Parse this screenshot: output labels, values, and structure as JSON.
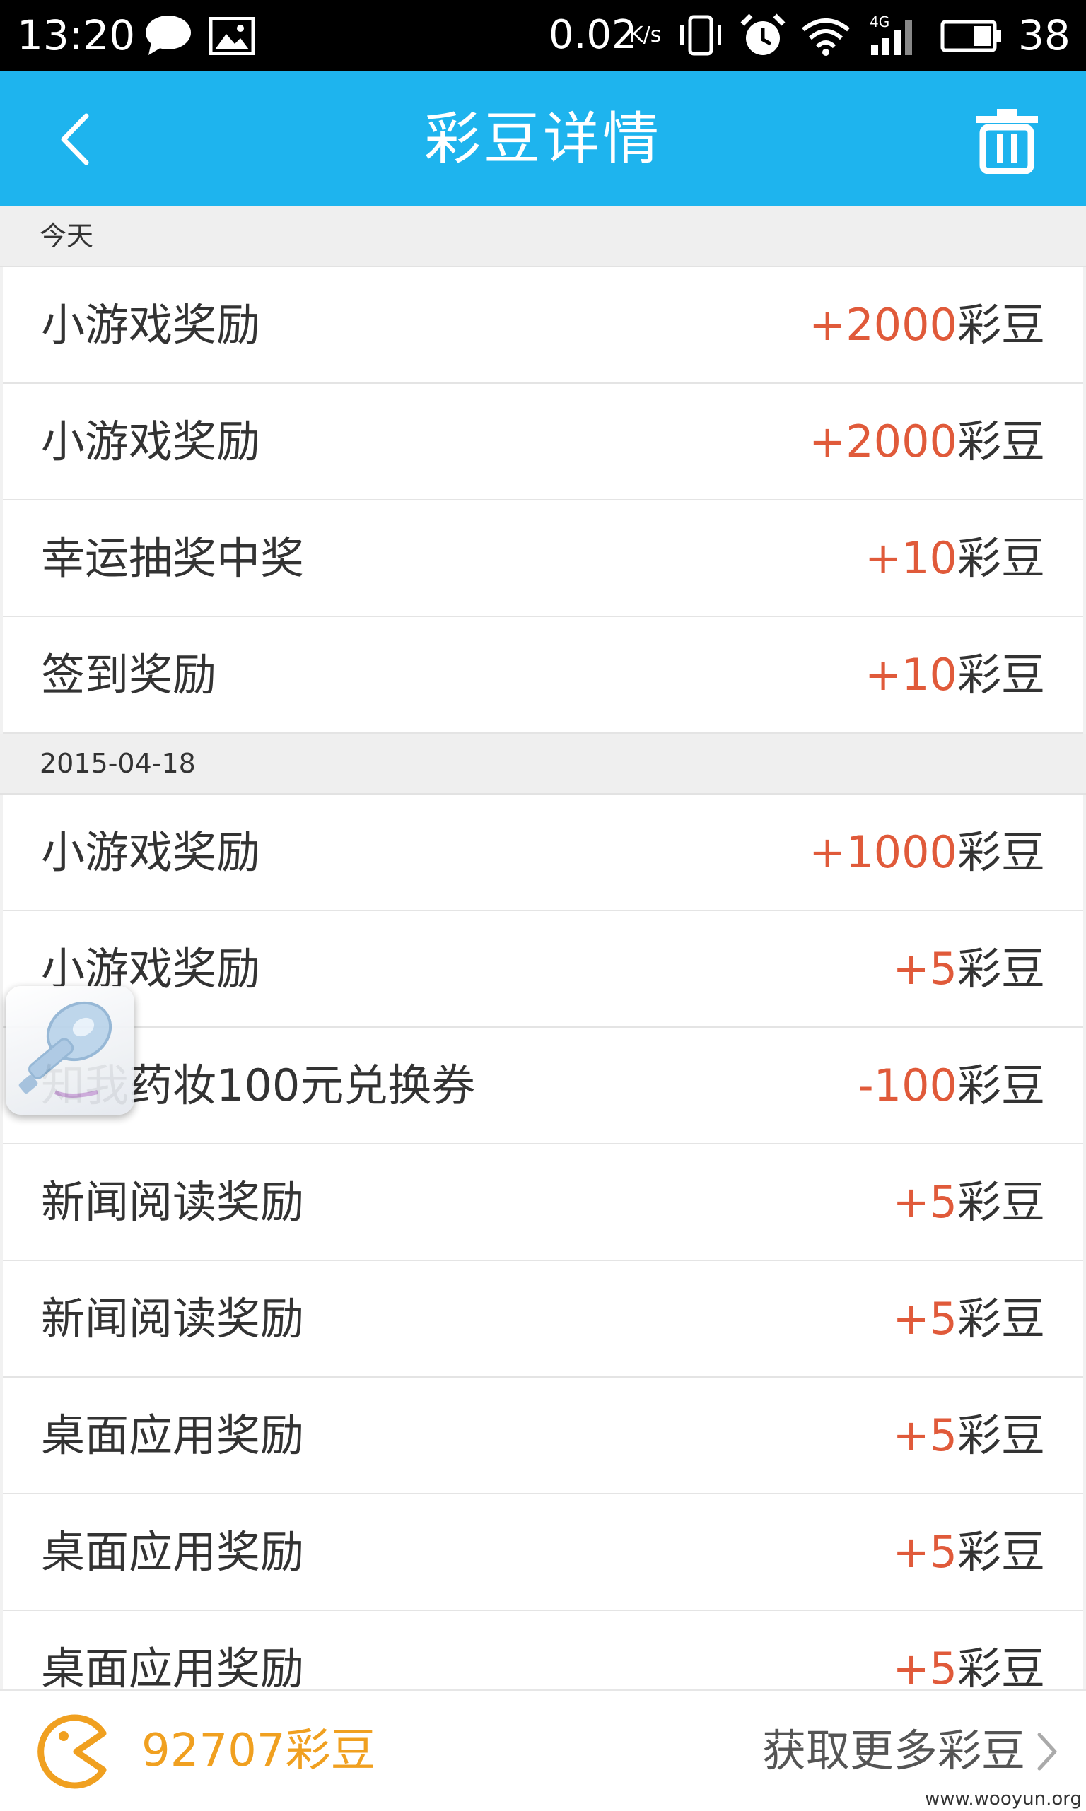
{
  "status_bar": {
    "time": "13:20",
    "net_speed": "0.02",
    "net_speed_unit": "K/s",
    "network_type": "4G",
    "battery_level": "38",
    "icons": [
      "message-icon",
      "image-icon",
      "vibrate-icon",
      "alarm-icon",
      "wifi-icon",
      "signal-icon",
      "battery-icon"
    ]
  },
  "header": {
    "title": "彩豆详情",
    "back_icon": "chevron-left-icon",
    "delete_icon": "trash-icon"
  },
  "sections": [
    {
      "header": "今天",
      "items": [
        {
          "label": "小游戏奖励",
          "amount": "+2000",
          "unit": "彩豆"
        },
        {
          "label": "小游戏奖励",
          "amount": "+2000",
          "unit": "彩豆"
        },
        {
          "label": "幸运抽奖中奖",
          "amount": "+10",
          "unit": "彩豆"
        },
        {
          "label": "签到奖励",
          "amount": "+10",
          "unit": "彩豆"
        }
      ]
    },
    {
      "header": "2015-04-18",
      "items": [
        {
          "label": "小游戏奖励",
          "amount": "+1000",
          "unit": "彩豆"
        },
        {
          "label": "小游戏奖励",
          "amount": "+5",
          "unit": "彩豆"
        },
        {
          "label": "知我药妆100元兑换券",
          "amount": "-100",
          "unit": "彩豆"
        },
        {
          "label": "新闻阅读奖励",
          "amount": "+5",
          "unit": "彩豆"
        },
        {
          "label": "新闻阅读奖励",
          "amount": "+5",
          "unit": "彩豆"
        },
        {
          "label": "桌面应用奖励",
          "amount": "+5",
          "unit": "彩豆"
        },
        {
          "label": "桌面应用奖励",
          "amount": "+5",
          "unit": "彩豆"
        },
        {
          "label": "桌面应用奖励",
          "amount": "+5",
          "unit": "彩豆"
        }
      ]
    }
  ],
  "footer": {
    "balance": "92707彩豆",
    "more_link": "获取更多彩豆",
    "watermark": "www.wooyun.org"
  },
  "colors": {
    "header_bg": "#1eb4ee",
    "amount": "#e05a3a",
    "balance": "#f0a020"
  }
}
